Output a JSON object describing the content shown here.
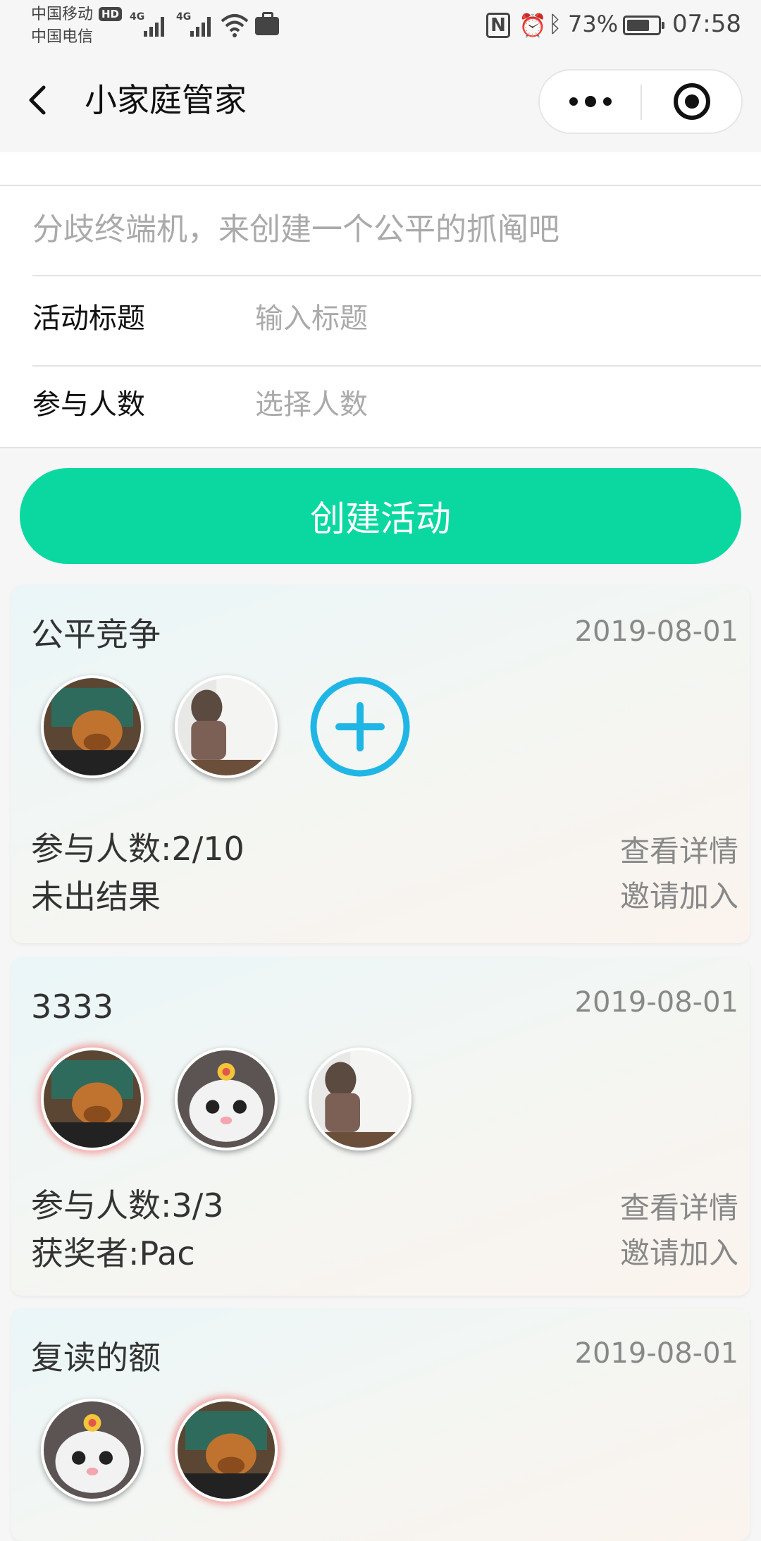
{
  "status_bar": {
    "carrier_1": "中国移动",
    "carrier_2": "中国电信",
    "hd_badge": "HD",
    "network_1": "4G",
    "network_2": "4G",
    "battery_percent": "73%",
    "battery_level": 0.73,
    "time": "07:58",
    "icons": [
      "signal-icon",
      "wifi-icon",
      "briefcase-icon",
      "nfc-icon",
      "alarm-icon",
      "bluetooth-icon",
      "battery-icon"
    ]
  },
  "navbar": {
    "title": "小家庭管家"
  },
  "form": {
    "notice": "分歧终端机，来创建一个公平的抓阄吧",
    "title_label": "活动标题",
    "title_placeholder": "输入标题",
    "count_label": "参与人数",
    "count_placeholder": "选择人数"
  },
  "create_button": "创建活动",
  "activities": [
    {
      "title": "公平竞争",
      "date": "2019-08-01",
      "participants_text": "参与人数:2/10",
      "result_text": "未出结果",
      "details_link": "查看详情",
      "invite_link": "邀请加入",
      "avatars": [
        "dog-avatar",
        "child-avatar"
      ],
      "show_add": true
    },
    {
      "title": "3333",
      "date": "2019-08-01",
      "participants_text": "参与人数:3/3",
      "result_text": "获奖者:Pac",
      "details_link": "查看详情",
      "invite_link": "邀请加入",
      "avatars": [
        "dog-avatar",
        "cat-avatar",
        "child-avatar"
      ],
      "show_add": false
    },
    {
      "title": "复读的额",
      "date": "2019-08-01",
      "avatars": [
        "cat-avatar",
        "dog-avatar"
      ],
      "show_add": false
    }
  ],
  "colors": {
    "accent_green": "#0bd8a0",
    "add_button_blue": "#1fb6e6",
    "winner_glow": "#f05a5a"
  }
}
